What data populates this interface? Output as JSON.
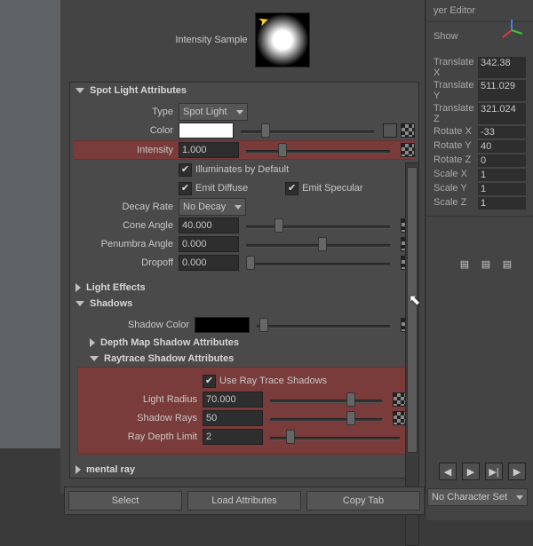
{
  "header": {
    "layer_editor": "yer Editor",
    "show": "Show"
  },
  "sample_label": "Intensity Sample",
  "sections": {
    "spot": {
      "title": "Spot Light Attributes",
      "type_label": "Type",
      "type_value": "Spot Light",
      "color_label": "Color",
      "color_value": "#ffffff",
      "intensity_label": "Intensity",
      "intensity_value": "1.000",
      "illum_default": "Illuminates by Default",
      "emit_diffuse": "Emit Diffuse",
      "emit_specular": "Emit Specular",
      "decay_label": "Decay Rate",
      "decay_value": "No Decay",
      "cone_label": "Cone Angle",
      "cone_value": "40.000",
      "penumbra_label": "Penumbra Angle",
      "penumbra_value": "0.000",
      "dropoff_label": "Dropoff",
      "dropoff_value": "0.000"
    },
    "light_effects": "Light Effects",
    "shadows": {
      "title": "Shadows",
      "color_label": "Shadow Color",
      "color_value": "#000000"
    },
    "depthmap": "Depth Map Shadow Attributes",
    "raytrace": {
      "title": "Raytrace Shadow Attributes",
      "use_rt": "Use Ray Trace Shadows",
      "radius_label": "Light Radius",
      "radius_value": "70.000",
      "rays_label": "Shadow Rays",
      "rays_value": "50",
      "depth_label": "Ray Depth Limit",
      "depth_value": "2"
    },
    "mental_ray": "mental ray"
  },
  "transforms": {
    "tx": {
      "lab": "Translate X",
      "val": "342.38"
    },
    "ty": {
      "lab": "Translate Y",
      "val": "511.029"
    },
    "tz": {
      "lab": "Translate Z",
      "val": "321.024"
    },
    "rx": {
      "lab": "Rotate X",
      "val": "-33"
    },
    "ry": {
      "lab": "Rotate Y",
      "val": "40"
    },
    "rz": {
      "lab": "Rotate Z",
      "val": "0"
    },
    "sx": {
      "lab": "Scale X",
      "val": "1"
    },
    "sy": {
      "lab": "Scale Y",
      "val": "1"
    },
    "sz": {
      "lab": "Scale Z",
      "val": "1"
    }
  },
  "footer": {
    "select": "Select",
    "load": "Load Attributes",
    "copy": "Copy Tab"
  },
  "char_set": "No Character Set",
  "icons": {
    "cursor": "➤",
    "ptr": "➤"
  }
}
